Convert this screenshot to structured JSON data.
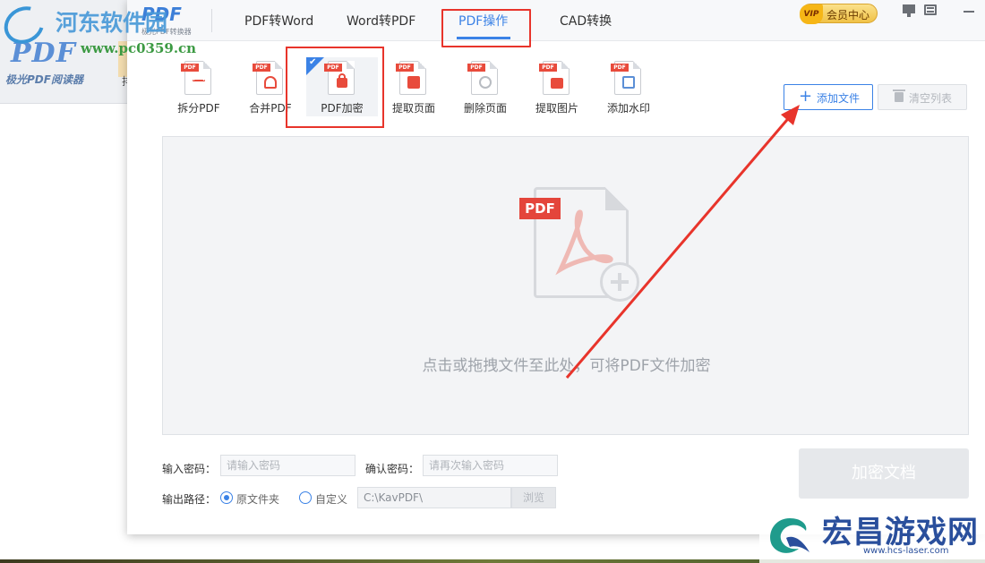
{
  "watermark_top": {
    "title": "河东软件园",
    "url": "www.pc0359.cn"
  },
  "background_window": {
    "logo": "PDF",
    "caption": "极光PDF阅读器",
    "partial_text": "排"
  },
  "app": {
    "brand": {
      "name": "PDF",
      "subtitle": "极光PDF转换器"
    },
    "nav": [
      "PDF转Word",
      "Word转PDF",
      "PDF操作",
      "CAD转换"
    ],
    "nav_active_index": 2,
    "vip": {
      "badge": "VIP",
      "label": "会员中心"
    },
    "accent_color": "#3b82e6",
    "highlight_color": "#e8342b"
  },
  "tools": [
    {
      "label": "拆分PDF",
      "icon": "split-pdf-icon",
      "tag": "PDF"
    },
    {
      "label": "合并PDF",
      "icon": "merge-pdf-icon",
      "tag": "PDF"
    },
    {
      "label": "PDF加密",
      "icon": "encrypt-pdf-icon",
      "tag": "PDF",
      "selected": true
    },
    {
      "label": "提取页面",
      "icon": "extract-page-icon",
      "tag": "PDF"
    },
    {
      "label": "删除页面",
      "icon": "delete-page-icon",
      "tag": "PDF"
    },
    {
      "label": "提取图片",
      "icon": "extract-image-icon",
      "tag": "PDF"
    },
    {
      "label": "添加水印",
      "icon": "add-watermark-icon",
      "tag": "PDF"
    }
  ],
  "actions": {
    "add_file": "添加文件",
    "clear_list": "清空列表"
  },
  "dropzone": {
    "tag": "PDF",
    "hint": "点击或拖拽文件至此处，可将PDF文件加密"
  },
  "form": {
    "password_label": "输入密码：",
    "password_placeholder": "请输入密码",
    "confirm_label": "确认密码：",
    "confirm_placeholder": "请再次输入密码",
    "output_label": "输出路径：",
    "option_original": "原文件夹",
    "option_custom": "自定义",
    "path_value": "C:\\KavPDF\\",
    "browse": "浏览",
    "submit": "加密文档"
  },
  "watermark_bottom": {
    "title": "宏昌游戏网",
    "url": "www.hcs-laser.com"
  }
}
